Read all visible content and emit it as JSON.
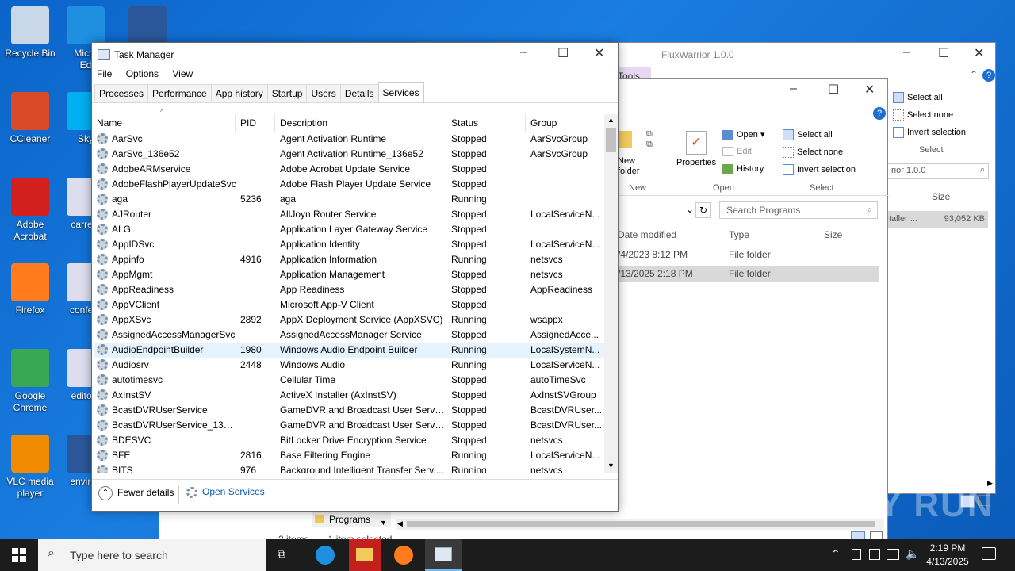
{
  "desktop": {
    "icons": [
      {
        "name": "recycle-bin",
        "label": "Recycle Bin",
        "color": "#c8d8e8"
      },
      {
        "name": "edge",
        "label": "Micro\nEd",
        "color": "#1f8fe0"
      },
      {
        "name": "word",
        "label": "",
        "color": "#2b579a"
      },
      {
        "name": "ccleaner",
        "label": "CCleaner",
        "color": "#d84a2a"
      },
      {
        "name": "skype",
        "label": "Sky",
        "color": "#00aff0"
      },
      {
        "name": "adobe-acrobat",
        "label": "Adobe\nAcrobat",
        "color": "#d41f1f"
      },
      {
        "name": "carreta",
        "label": "carreta",
        "color": "#dde"
      },
      {
        "name": "firefox",
        "label": "Firefox",
        "color": "#ff7b1c"
      },
      {
        "name": "conferen",
        "label": "confere",
        "color": "#dde"
      },
      {
        "name": "chrome",
        "label": "Google\nChrome",
        "color": "#3aa757"
      },
      {
        "name": "editora",
        "label": "editora",
        "color": "#dde"
      },
      {
        "name": "vlc",
        "label": "VLC media\nplayer",
        "color": "#f08a00"
      },
      {
        "name": "environ",
        "label": "environ",
        "color": "#2b579a"
      }
    ]
  },
  "bgwin1": {
    "title": "FluxWarrior 1.0.0",
    "tools": "Tools",
    "select_all": "Select all",
    "select_none": "Select none",
    "invert": "Invert selection",
    "select_group": "Select",
    "path": "rior 1.0.0",
    "size_hdr": "Size",
    "row_name": "taller ...",
    "row_size": "93,052 KB"
  },
  "bgwin2": {
    "new_folder": "New\nfolder",
    "new_group": "New",
    "properties": "Properties",
    "open": "Open",
    "edit": "Edit",
    "history": "History",
    "open_group": "Open",
    "select_all": "Select all",
    "select_none": "Select none",
    "invert": "Invert selection",
    "select_group": "Select",
    "search_placeholder": "Search Programs",
    "col_date": "Date modified",
    "col_type": "Type",
    "col_size": "Size",
    "rows": [
      {
        "date": "/4/2023 8:12 PM",
        "type": "File folder"
      },
      {
        "date": "/13/2025 2:18 PM",
        "type": "File folder"
      }
    ],
    "status_items": "2 items",
    "status_sel": "1 item selected",
    "folder": "Programs"
  },
  "tm": {
    "title": "Task Manager",
    "menu": [
      "File",
      "Options",
      "View"
    ],
    "tabs": [
      "Processes",
      "Performance",
      "App history",
      "Startup",
      "Users",
      "Details",
      "Services"
    ],
    "headers": {
      "name": "Name",
      "pid": "PID",
      "desc": "Description",
      "status": "Status",
      "group": "Group"
    },
    "rows": [
      [
        "AarSvc",
        "",
        "Agent Activation Runtime",
        "Stopped",
        "AarSvcGroup"
      ],
      [
        "AarSvc_136e52",
        "",
        "Agent Activation Runtime_136e52",
        "Stopped",
        "AarSvcGroup"
      ],
      [
        "AdobeARMservice",
        "",
        "Adobe Acrobat Update Service",
        "Stopped",
        ""
      ],
      [
        "AdobeFlashPlayerUpdateSvc",
        "",
        "Adobe Flash Player Update Service",
        "Stopped",
        ""
      ],
      [
        "aga",
        "5236",
        "aga",
        "Running",
        ""
      ],
      [
        "AJRouter",
        "",
        "AllJoyn Router Service",
        "Stopped",
        "LocalServiceN..."
      ],
      [
        "ALG",
        "",
        "Application Layer Gateway Service",
        "Stopped",
        ""
      ],
      [
        "AppIDSvc",
        "",
        "Application Identity",
        "Stopped",
        "LocalServiceN..."
      ],
      [
        "Appinfo",
        "4916",
        "Application Information",
        "Running",
        "netsvcs"
      ],
      [
        "AppMgmt",
        "",
        "Application Management",
        "Stopped",
        "netsvcs"
      ],
      [
        "AppReadiness",
        "",
        "App Readiness",
        "Stopped",
        "AppReadiness"
      ],
      [
        "AppVClient",
        "",
        "Microsoft App-V Client",
        "Stopped",
        ""
      ],
      [
        "AppXSvc",
        "2892",
        "AppX Deployment Service (AppXSVC)",
        "Running",
        "wsappx"
      ],
      [
        "AssignedAccessManagerSvc",
        "",
        "AssignedAccessManager Service",
        "Stopped",
        "AssignedAcce..."
      ],
      [
        "AudioEndpointBuilder",
        "1980",
        "Windows Audio Endpoint Builder",
        "Running",
        "LocalSystemN..."
      ],
      [
        "Audiosrv",
        "2448",
        "Windows Audio",
        "Running",
        "LocalServiceN..."
      ],
      [
        "autotimesvc",
        "",
        "Cellular Time",
        "Stopped",
        "autoTimeSvc"
      ],
      [
        "AxInstSV",
        "",
        "ActiveX Installer (AxInstSV)",
        "Stopped",
        "AxInstSVGroup"
      ],
      [
        "BcastDVRUserService",
        "",
        "GameDVR and Broadcast User Service",
        "Stopped",
        "BcastDVRUser..."
      ],
      [
        "BcastDVRUserService_136e52",
        "",
        "GameDVR and Broadcast User Servic...",
        "Stopped",
        "BcastDVRUser..."
      ],
      [
        "BDESVC",
        "",
        "BitLocker Drive Encryption Service",
        "Stopped",
        "netsvcs"
      ],
      [
        "BFE",
        "2816",
        "Base Filtering Engine",
        "Running",
        "LocalServiceN..."
      ],
      [
        "BITS",
        "976",
        "Background Intelligent Transfer Servi...",
        "Running",
        "netsvcs"
      ]
    ],
    "selected_row": 14,
    "fewer_details": "Fewer details",
    "open_services": "Open Services"
  },
  "taskbar": {
    "search_placeholder": "Type here to search",
    "time": "2:19 PM",
    "date": "4/13/2025"
  },
  "watermark": "ANY RUN"
}
